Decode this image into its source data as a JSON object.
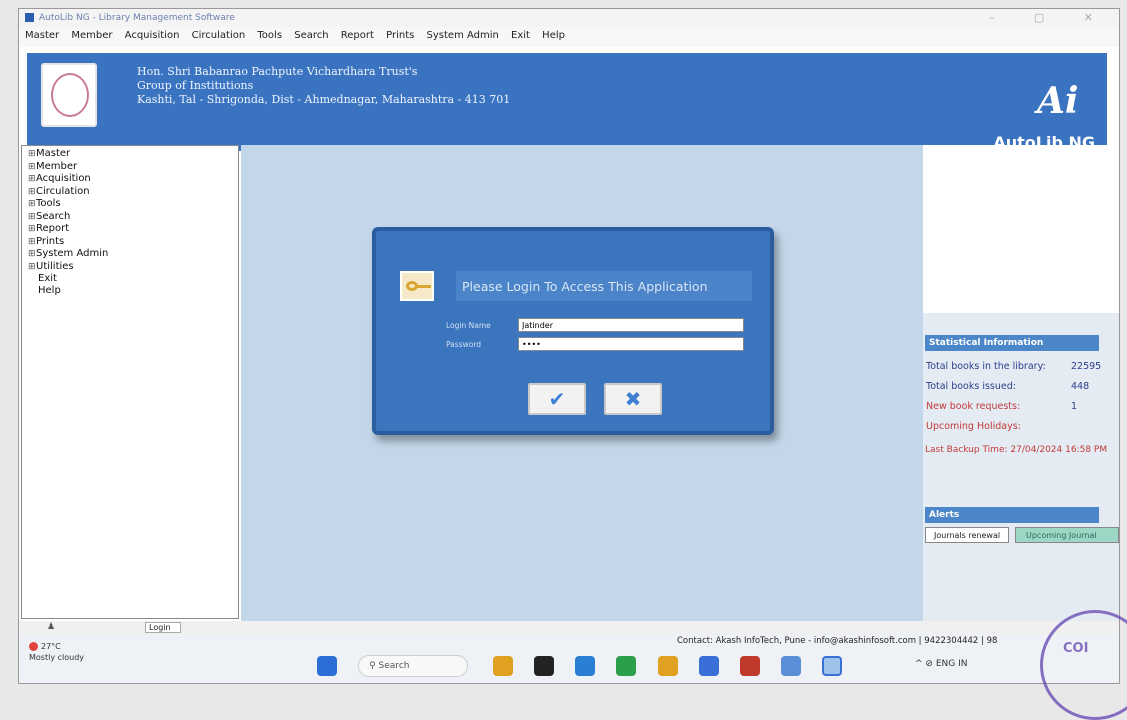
{
  "window": {
    "title": "AutoLib NG - Library Management Software"
  },
  "menubar": [
    "Master",
    "Member",
    "Acquisition",
    "Circulation",
    "Tools",
    "Search",
    "Report",
    "Prints",
    "System Admin",
    "Exit",
    "Help"
  ],
  "banner": {
    "line1": "Hon. Shri Babanrao Pachpute Vichardhara Trust's",
    "line2": "Group of Institutions",
    "line3": "Kashti, Tal - Shrigonda, Dist - Ahmednagar, Maharashtra - 413 701",
    "brand": "AutoLib NG",
    "brand_mark": "Ai"
  },
  "tree": {
    "expandable": [
      "Master",
      "Member",
      "Acquisition",
      "Circulation",
      "Tools",
      "Search",
      "Report",
      "Prints",
      "System Admin",
      "Utilities"
    ],
    "plain": [
      "Exit",
      "Help"
    ]
  },
  "login": {
    "title": "Please Login To Access This Application",
    "login_label": "Login Name",
    "login_value": "Jatinder",
    "password_label": "Password",
    "password_value": "••••",
    "ok_glyph": "✔",
    "cancel_glyph": "✖"
  },
  "stats": {
    "heading": "Statistical Information",
    "rows": [
      {
        "label": "Total books in the library:",
        "value": "22595"
      },
      {
        "label": "Total books issued:",
        "value": "448"
      },
      {
        "label": "New book requests:",
        "value": "1"
      },
      {
        "label": "Upcoming Holidays:",
        "value": ""
      }
    ],
    "backup": "Last Backup Time: 27/04/2024 16:58 PM"
  },
  "alerts": {
    "heading": "Alerts",
    "tab1": "Journals renewal",
    "tab2": "Upcoming Journal"
  },
  "statusbar": {
    "login": "Login"
  },
  "taskbar": {
    "temp": "27°C",
    "weather": "Mostly cloudy",
    "search": "Search",
    "contact": "Contact: Akash InfoTech, Pune - info@akashinfosoft.com | 9422304442 | 98",
    "lang": "ENG",
    "lang2": "IN",
    "icon_colors": [
      "#2b6fd6",
      "#222222",
      "#2a7fd4",
      "#e0a020",
      "#2aa04a",
      "#c0392b",
      "#3a6fd8",
      "#5a8fd8"
    ]
  },
  "stamp": "COI"
}
